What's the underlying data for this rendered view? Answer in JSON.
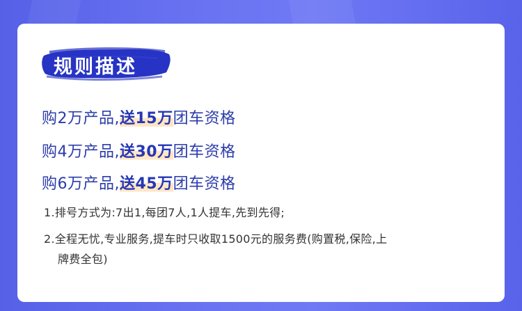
{
  "section_title": "规则描述",
  "rules": [
    {
      "prefix": "购2万产品,",
      "emphasis": "送15万",
      "suffix": "团车资格"
    },
    {
      "prefix": "购4万产品,",
      "emphasis": "送30万",
      "suffix": "团车资格"
    },
    {
      "prefix": "购6万产品,",
      "emphasis": "送45万",
      "suffix": "团车资格"
    }
  ],
  "notes": [
    {
      "line1": "1.排号方式为:7出1,每团7人,1人提车,先到先得;",
      "line2": ""
    },
    {
      "line1": "2.全程无忧,专业服务,提车时只收取1500元的服务费(购置税,保险,上",
      "line2": "牌费全包)"
    }
  ],
  "colors": {
    "background": "#6a74f2",
    "title_brush": "#2633c4",
    "rule_text": "#2b3caa",
    "highlight": "#ffe6c4",
    "note_text": "#333333"
  }
}
